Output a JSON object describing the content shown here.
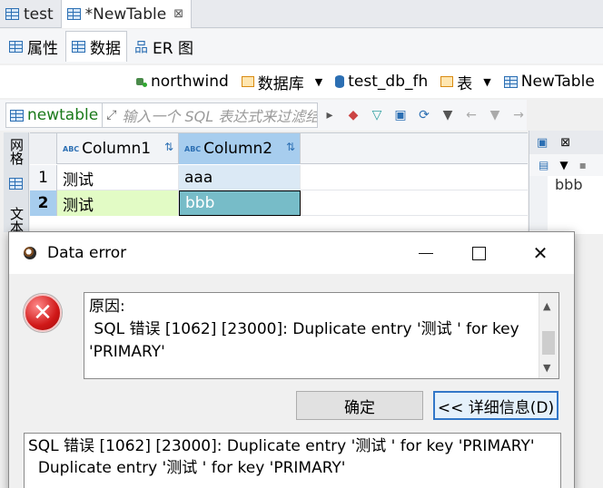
{
  "editor_tabs": [
    {
      "label": "test",
      "close": ""
    },
    {
      "label": "*NewTable",
      "close": "⊠"
    }
  ],
  "sub_tabs": [
    {
      "label": "属性"
    },
    {
      "label": "数据"
    },
    {
      "label": "ER 图"
    }
  ],
  "breadcrumb": {
    "connection": "northwind",
    "database": "数据库",
    "schema": "test_db_fh",
    "tables": "表",
    "table": "NewTable"
  },
  "filter": {
    "entity": "newtable",
    "placeholder": "输入一个 SQL 表达式来过滤结果 (使"
  },
  "side_tabs": {
    "grid": "网格",
    "text": "文本"
  },
  "grid": {
    "columns": [
      "Column1",
      "Column2"
    ],
    "rows": [
      {
        "num": "1",
        "c1": "测试",
        "c2": "aaa"
      },
      {
        "num": "2",
        "c1": "测试",
        "c2": "bbb"
      }
    ]
  },
  "right_panel": {
    "value": "bbb"
  },
  "dialog": {
    "title": "Data error",
    "message": "原因:\n SQL 错误 [1062] [23000]: Duplicate entry '测试 ' for key\n'PRIMARY'",
    "ok_label": "确定",
    "details_label": "<< 详细信息(D)",
    "details": "SQL 错误 [1062] [23000]: Duplicate entry '测试 ' for key 'PRIMARY'\n  Duplicate entry '测试 ' for key 'PRIMARY'"
  },
  "colors": {
    "selected_header": "#a7cdee",
    "modified_cell": "#e2fbc5",
    "selected_cell": "#77bcc8",
    "error_red": "#d01818"
  }
}
